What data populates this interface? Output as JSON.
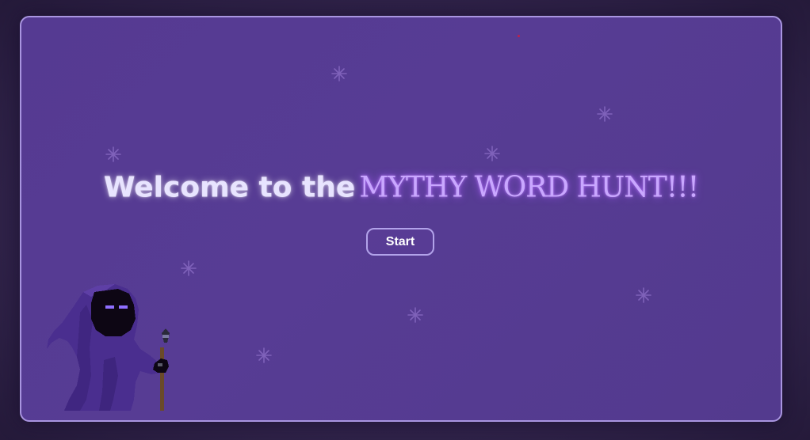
{
  "title": {
    "welcome_text": "Welcome to the",
    "game_name": "MYTHY WORD HUNT!!!"
  },
  "start_button": {
    "label": "Start"
  },
  "character": {
    "icon": "hooded-wizard-with-staff-icon"
  },
  "decorations": {
    "sparkle_icon": "sparkle-icon",
    "sparkle_count": 10
  },
  "colors": {
    "background": "#2f2248",
    "panel": "#553a92",
    "panel_border": "#a995e0",
    "welcome_text": "#e8e4ff",
    "game_name": "#c9a7ff",
    "wizard_robe": "#4a2e8f",
    "wizard_eyes": "#8f6fff",
    "accent_dot": "#c0204a"
  }
}
